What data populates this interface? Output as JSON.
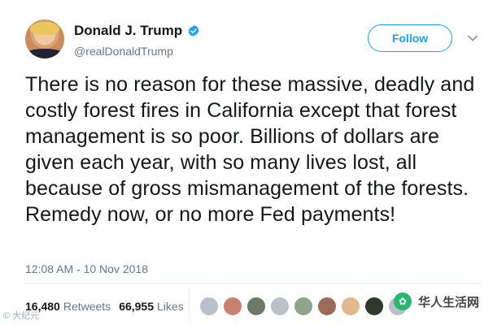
{
  "author": {
    "display_name": "Donald J. Trump",
    "handle": "@realDonaldTrump",
    "verified": true
  },
  "follow_label": "Follow",
  "tweet": {
    "text": "There is no reason for these massive, deadly and costly forest fires in California except that forest management is so poor. Billions of dollars are given each year, with so many lives lost, all because of gross mismanagement of the forests. Remedy now, or no more Fed payments!",
    "timestamp": "12:08 AM - 10 Nov 2018"
  },
  "stats": {
    "retweets_count": "16,480",
    "retweets_label": "Retweets",
    "likes_count": "66,955",
    "likes_label": "Likes"
  },
  "likers": [
    {
      "color": "#b8c1c9"
    },
    {
      "color": "#c9826f"
    },
    {
      "color": "#6b7b66"
    },
    {
      "color": "#b8c1c9"
    },
    {
      "color": "#8fa389"
    },
    {
      "color": "#9c6a5a"
    },
    {
      "color": "#e2b98f"
    },
    {
      "color": "#2f3a2f"
    },
    {
      "color": "#b8c1c9"
    }
  ],
  "watermarks": {
    "right_text": "华人生活网",
    "left_text": "© 大纪元"
  },
  "colors": {
    "accent": "#1da1f2",
    "text": "#14171a",
    "secondary_text": "#657786"
  }
}
